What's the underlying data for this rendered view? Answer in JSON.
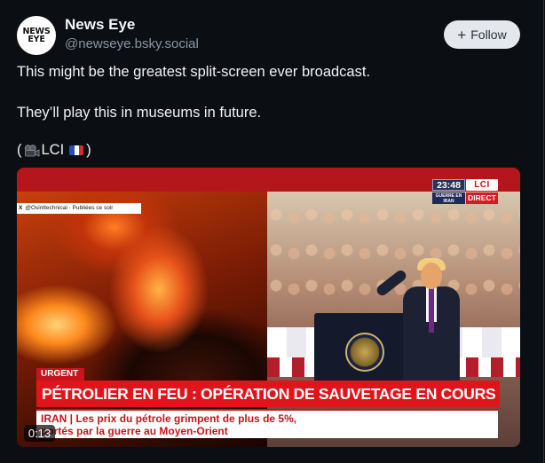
{
  "author": {
    "avatar_line1": "NEWS",
    "avatar_line2": "EYE",
    "display_name": "News Eye",
    "handle": "@newseye.bsky.social"
  },
  "follow_button": {
    "icon": "plus-icon",
    "label": "Follow"
  },
  "post": {
    "line1": "This might be the greatest split-screen ever broadcast.",
    "line2": "They’ll play this in museums in future.",
    "line3_open": "(",
    "line3_camera": "movie-camera-icon",
    "line3_source": "LCI",
    "line3_flag": "france-flag-icon",
    "line3_close": ")"
  },
  "video": {
    "source_tag": "@Osinttechnical · Publiées ce soir",
    "clock": "23:48",
    "guerre_label": "GUERRE EN IRAN",
    "channel_logo": "LCI",
    "direct_label": "DIRECT",
    "urgent_label": "URGENT",
    "headline": "PÉTROLIER EN FEU : OPÉRATION DE SAUVETAGE EN COURS",
    "sub_strong": "IRAN",
    "sub_line1_rest": " | Les prix du pétrole grimpent de plus de 5%,",
    "sub_line2": "portés par la guerre au Moyen-Orient",
    "timestamp": "0:13"
  },
  "colors": {
    "background": "#0b0f14",
    "follow_bg": "#e4e7eb",
    "lci_red": "#e2141b",
    "handle_gray": "#8a96a3"
  }
}
